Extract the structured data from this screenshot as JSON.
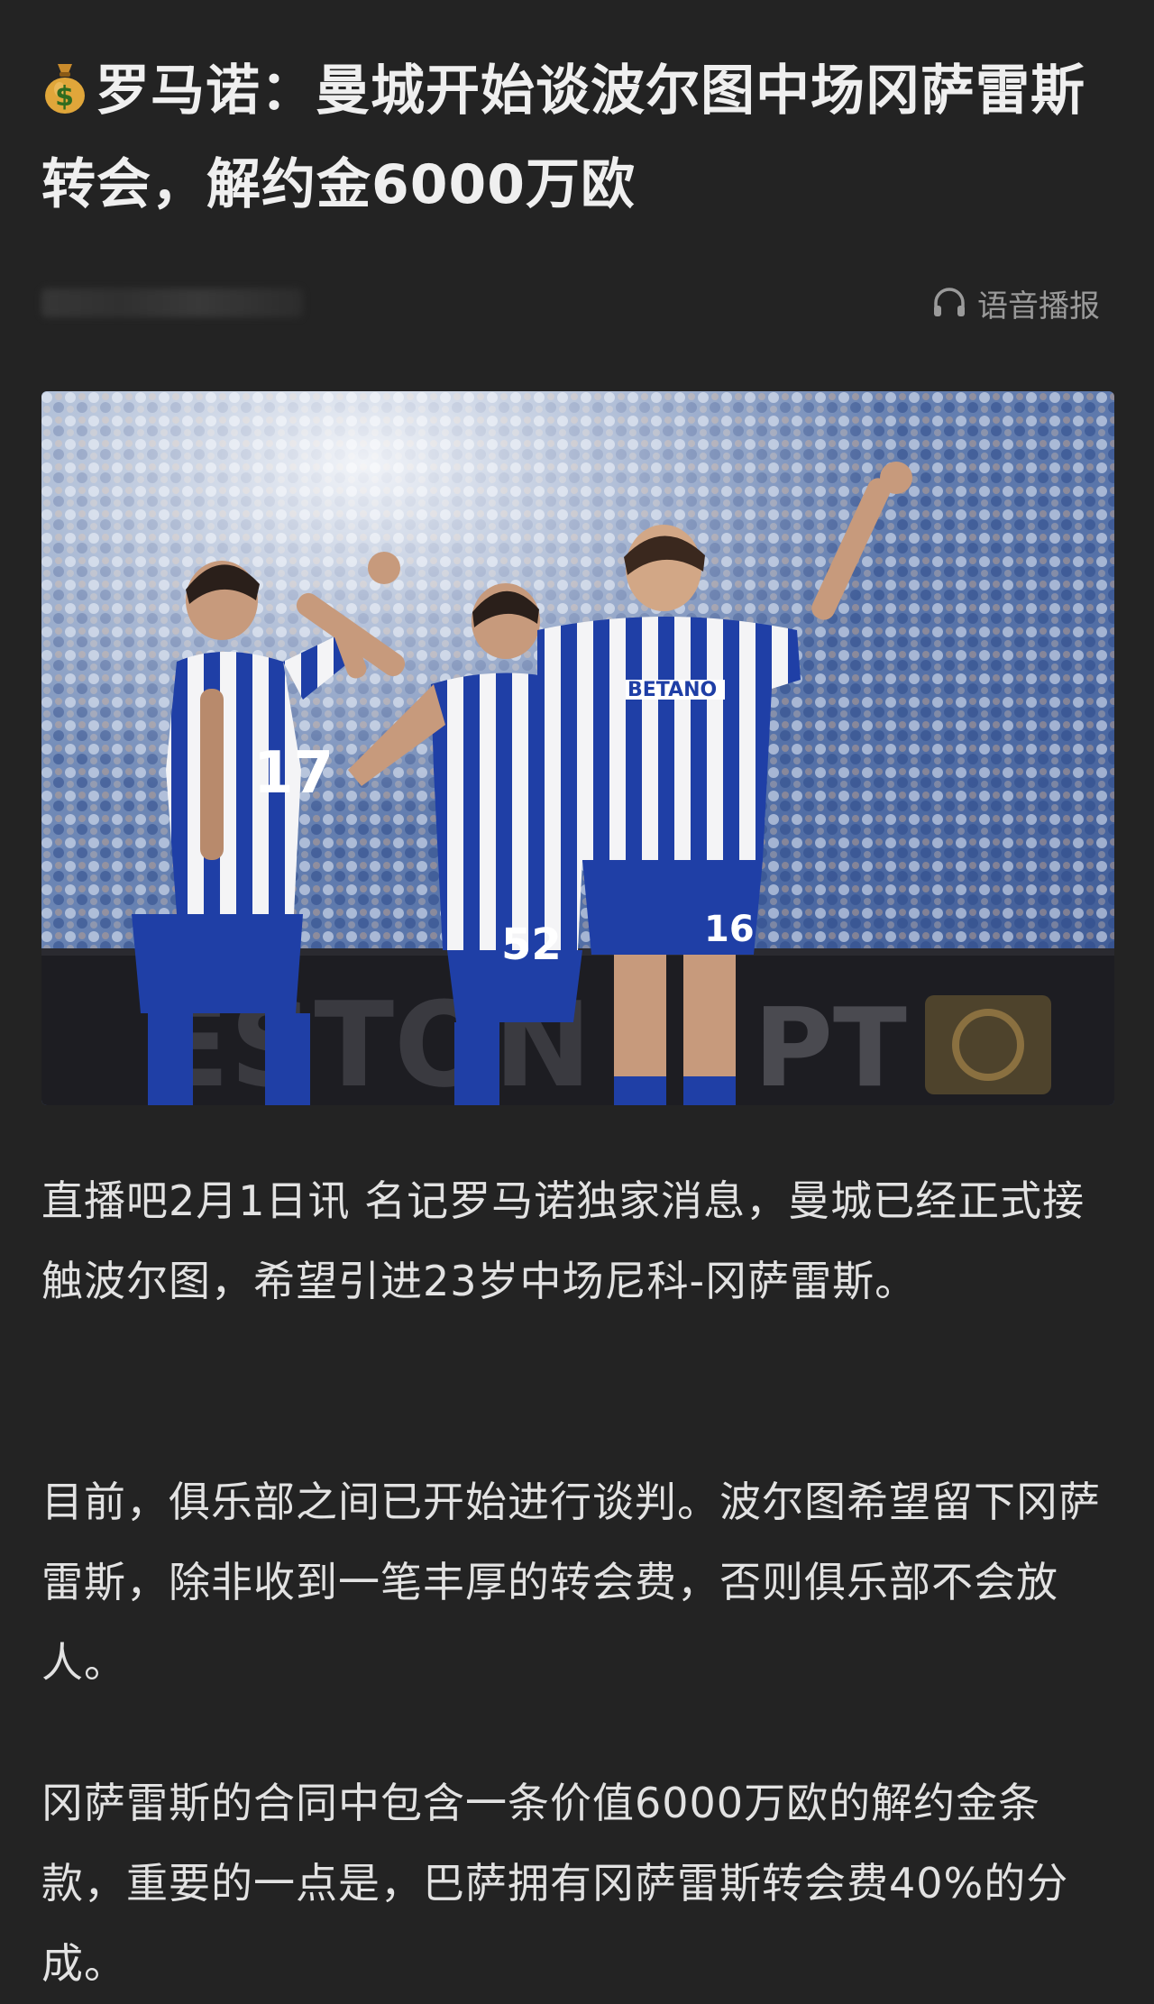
{
  "article": {
    "title_emoji_icon": "money-bag-icon",
    "title": "罗马诺：曼城开始谈波尔图中场冈萨雷斯转会，解约金6000万欧",
    "listen_label": "语音播报",
    "image_alt": "波尔图球员庆祝进球",
    "jersey_sponsor": "BETANO",
    "jersey_numbers": [
      "17",
      "52",
      "16"
    ],
    "board_text": "PT",
    "paragraphs": [
      "直播吧2月1日讯  名记罗马诺独家消息，曼城已经正式接触波尔图，希望引进23岁中场尼科-冈萨雷斯。",
      "目前，俱乐部之间已开始进行谈判。波尔图希望留下冈萨雷斯，除非收到一笔丰厚的转会费，否则俱乐部不会放人。",
      "冈萨雷斯的合同中包含一条价值6000万欧的解约金条款，重要的一点是，巴萨拥有冈萨雷斯转会费40%的分成。"
    ]
  },
  "colors": {
    "background": "#232323",
    "title_text": "#efefef",
    "body_text": "#e2e2e2",
    "muted_text": "#9a9a9a",
    "porto_blue": "#1f3fa6"
  }
}
